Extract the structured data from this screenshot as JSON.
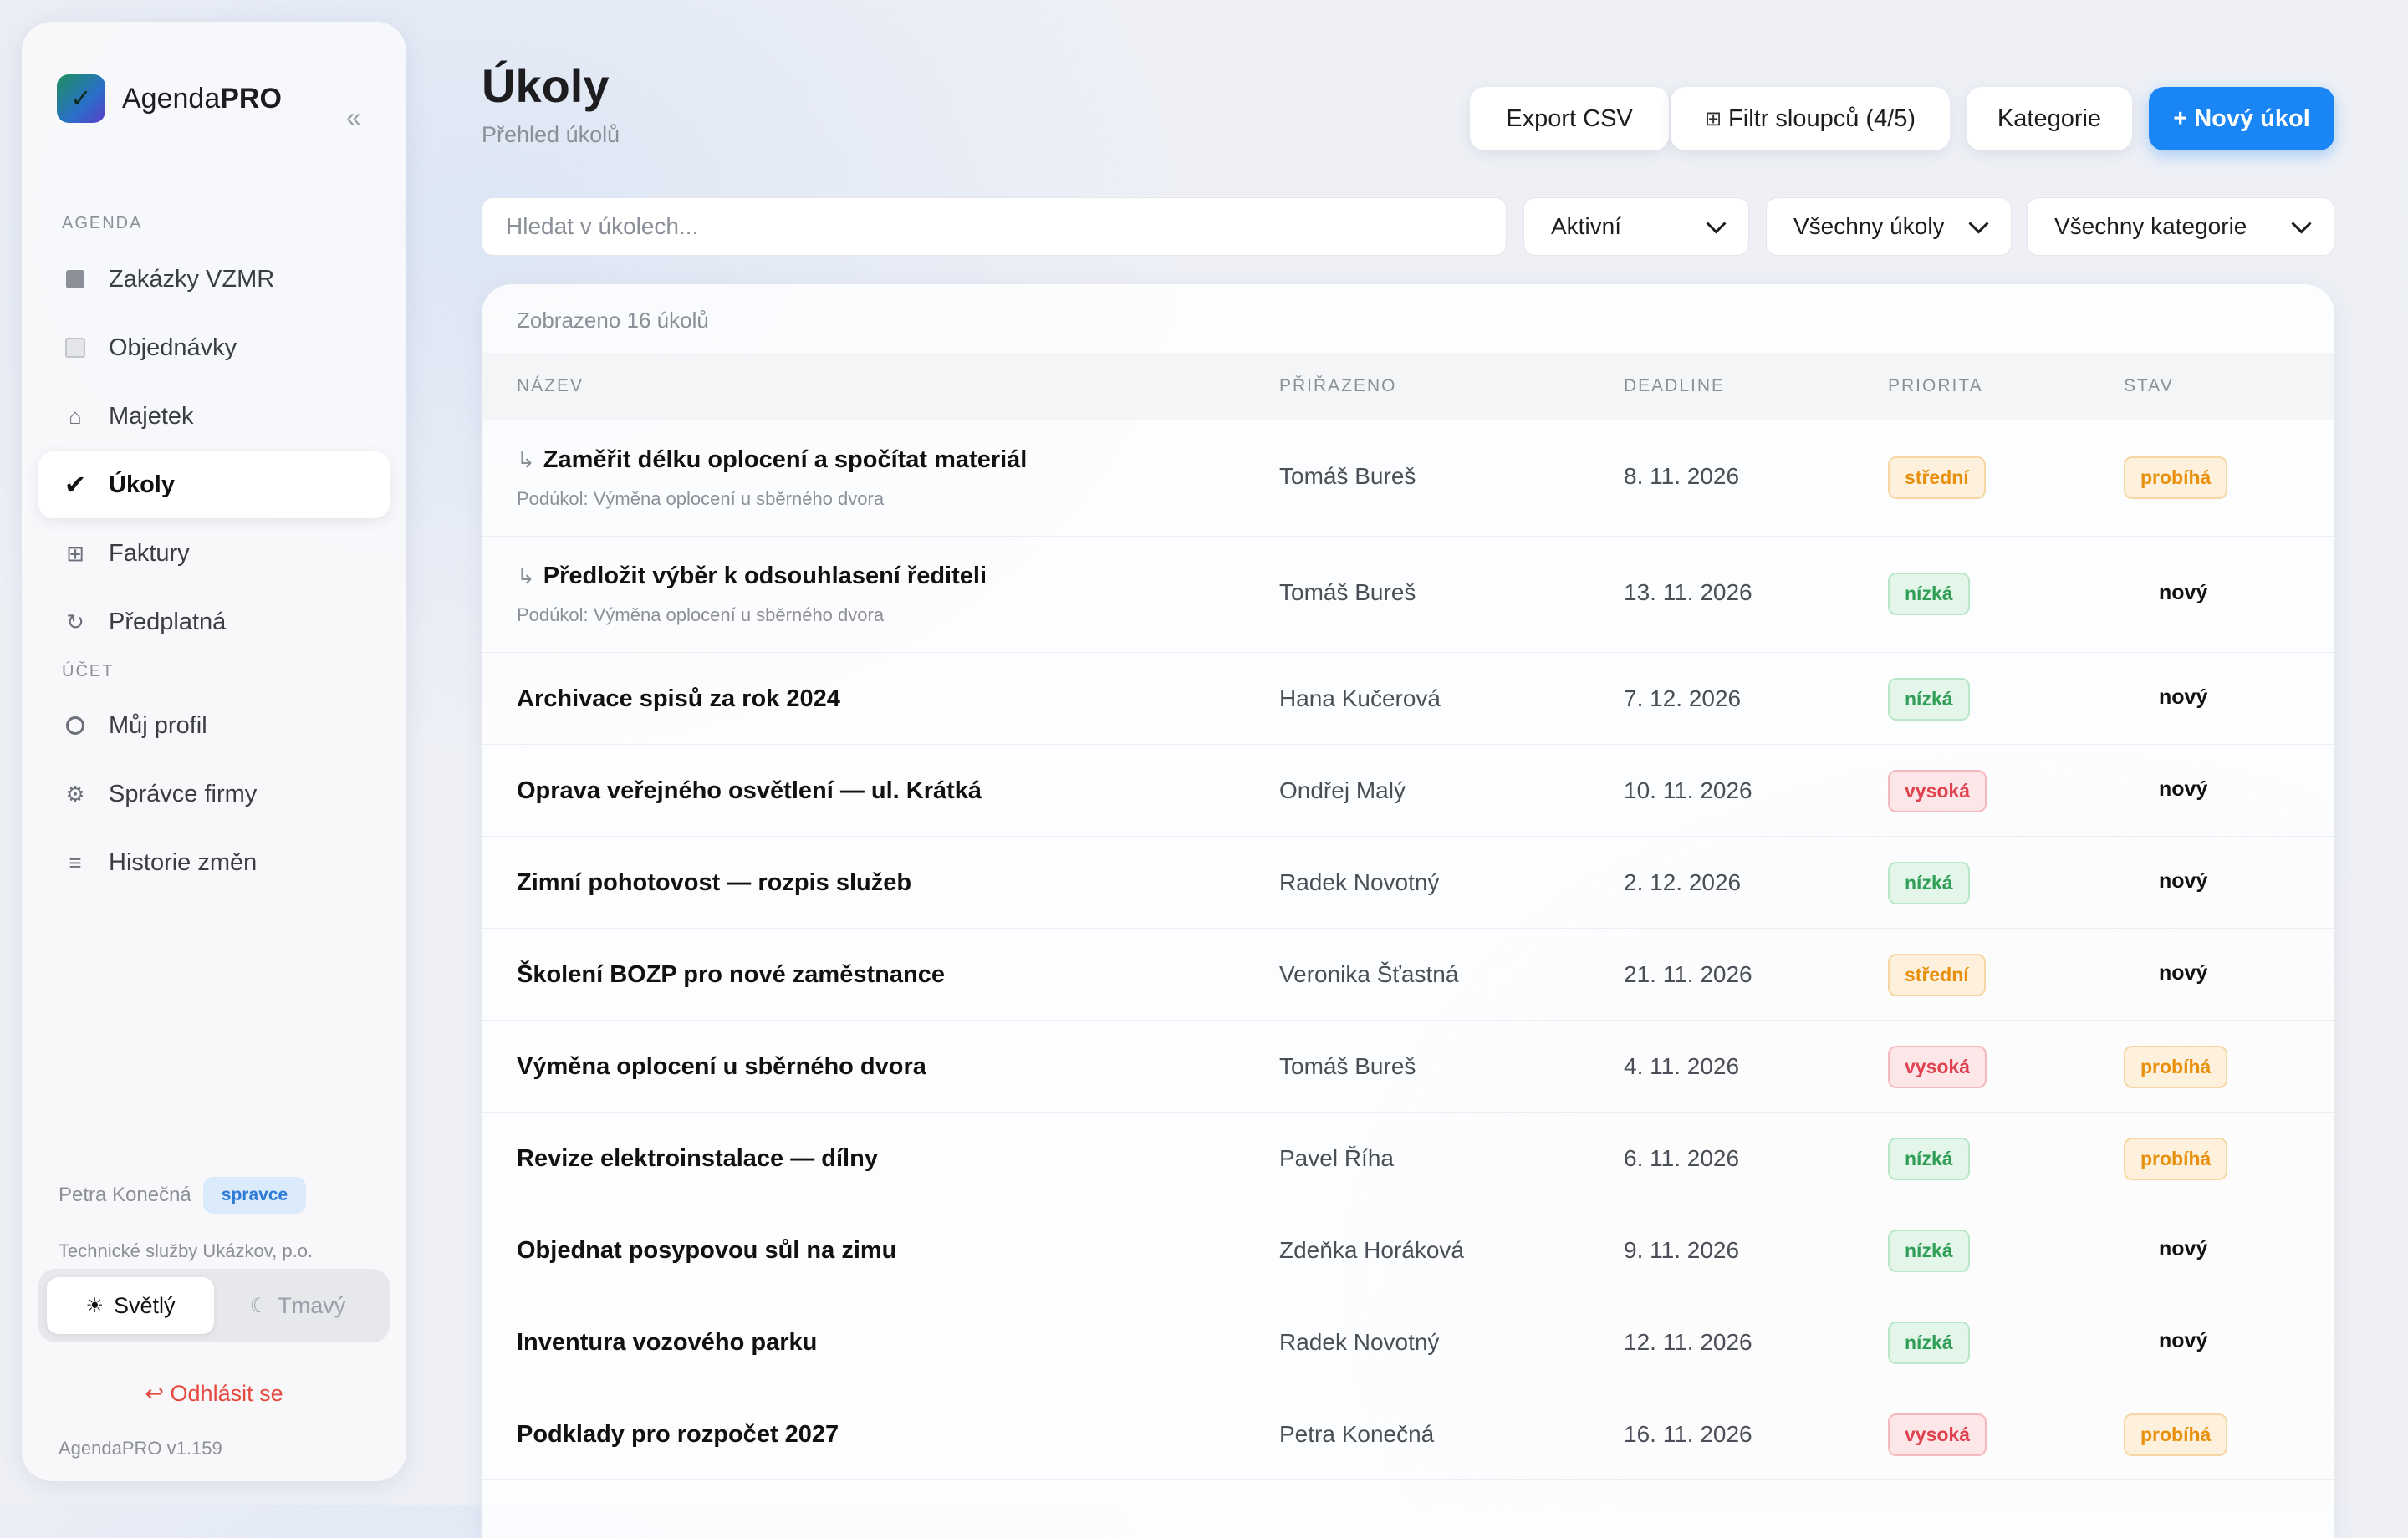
{
  "app": {
    "name_regular": "Agenda",
    "name_bold": "PRO",
    "collapse_icon": "«",
    "version": "AgendaPRO v1.159"
  },
  "sidebar": {
    "section_agenda": "AGENDA",
    "section_account": "ÚČET",
    "items": [
      {
        "label": "Zakázky VZMR",
        "icon": "square-filled-icon"
      },
      {
        "label": "Objednávky",
        "icon": "square-outline-icon"
      },
      {
        "label": "Majetek",
        "icon": "house-icon"
      },
      {
        "label": "Úkoly",
        "icon": "checkmark-icon",
        "active": true
      },
      {
        "label": "Faktury",
        "icon": "grid-icon"
      },
      {
        "label": "Předplatná",
        "icon": "refresh-icon"
      },
      {
        "label": "Můj profil",
        "icon": "user-circle-icon"
      },
      {
        "label": "Správce firmy",
        "icon": "gear-icon"
      },
      {
        "label": "Historie změn",
        "icon": "list-icon"
      }
    ],
    "user": {
      "name": "Petra Konečná",
      "role": "spravce",
      "organization": "Technické služby Ukázkov, p.o."
    },
    "theme": {
      "light": "Světlý",
      "dark": "Tmavý",
      "selected": "light"
    },
    "logout": "Odhlásit se"
  },
  "page": {
    "title": "Úkoly",
    "subtitle": "Přehled úkolů"
  },
  "toolbar": {
    "export": "Export CSV",
    "column_filter": "Filtr sloupců (4/5)",
    "categories": "Kategorie",
    "new_task": "+ Nový úkol"
  },
  "filters": {
    "search_placeholder": "Hledat v úkolech...",
    "status": "Aktivní",
    "scope": "Všechny úkoly",
    "category": "Všechny kategorie"
  },
  "table": {
    "count_text": "Zobrazeno 16 úkolů",
    "headers": {
      "name": "NÁZEV",
      "assignee": "PŘIŘAZENO",
      "deadline": "DEADLINE",
      "priority": "PRIORITA",
      "state": "STAV"
    },
    "rows": [
      {
        "name": "Zaměřit délku oplocení a spočítat materiál",
        "subtask_of": "Podúkol: Výměna oplocení u sběrného dvora",
        "assignee": "Tomáš Bureš",
        "deadline": "8. 11. 2026",
        "priority": "střední",
        "priority_level": "medium",
        "state": "probíhá"
      },
      {
        "name": "Předložit výběr k odsouhlasení řediteli",
        "subtask_of": "Podúkol: Výměna oplocení u sběrného dvora",
        "assignee": "Tomáš Bureš",
        "deadline": "13. 11. 2026",
        "priority": "nízká",
        "priority_level": "low",
        "state": "nový"
      },
      {
        "name": "Archivace spisů za rok 2024",
        "assignee": "Hana Kučerová",
        "deadline": "7. 12. 2026",
        "priority": "nízká",
        "priority_level": "low",
        "state": "nový"
      },
      {
        "name": "Oprava veřejného osvětlení — ul. Krátká",
        "assignee": "Ondřej Malý",
        "deadline": "10. 11. 2026",
        "priority": "vysoká",
        "priority_level": "high",
        "state": "nový"
      },
      {
        "name": "Zimní pohotovost — rozpis služeb",
        "assignee": "Radek Novotný",
        "deadline": "2. 12. 2026",
        "priority": "nízká",
        "priority_level": "low",
        "state": "nový"
      },
      {
        "name": "Školení BOZP pro nové zaměstnance",
        "assignee": "Veronika Šťastná",
        "deadline": "21. 11. 2026",
        "priority": "střední",
        "priority_level": "medium",
        "state": "nový"
      },
      {
        "name": "Výměna oplocení u sběrného dvora",
        "assignee": "Tomáš Bureš",
        "deadline": "4. 11. 2026",
        "priority": "vysoká",
        "priority_level": "high",
        "state": "probíhá"
      },
      {
        "name": "Revize elektroinstalace — dílny",
        "assignee": "Pavel Říha",
        "deadline": "6. 11. 2026",
        "priority": "nízká",
        "priority_level": "low",
        "state": "probíhá"
      },
      {
        "name": "Objednat posypovou sůl na zimu",
        "assignee": "Zdeňka Horáková",
        "deadline": "9. 11. 2026",
        "priority": "nízká",
        "priority_level": "low",
        "state": "nový"
      },
      {
        "name": "Inventura vozového parku",
        "assignee": "Radek Novotný",
        "deadline": "12. 11. 2026",
        "priority": "nízká",
        "priority_level": "low",
        "state": "nový"
      },
      {
        "name": "Podklady pro rozpočet 2027",
        "assignee": "Petra Konečná",
        "deadline": "16. 11. 2026",
        "priority": "vysoká",
        "priority_level": "high",
        "state": "probíhá"
      }
    ]
  },
  "colors": {
    "accent": "#1a86f5",
    "low": "#2f9e57",
    "medium": "#e8900c",
    "high": "#e0414e",
    "logout": "#e5483d"
  }
}
